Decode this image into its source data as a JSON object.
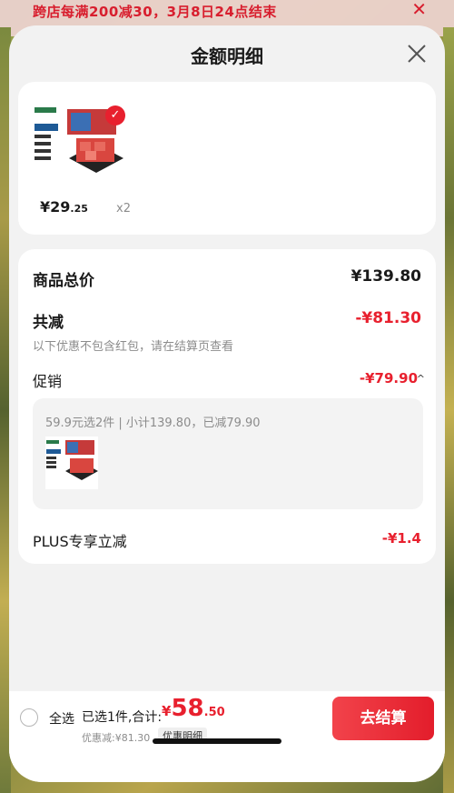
{
  "background_banner": {
    "text": "跨店每满200减30，3月8日24点结束",
    "close_icon": "close-icon"
  },
  "sheet": {
    "title": "金额明细",
    "close_icon": "close-icon"
  },
  "product": {
    "price_int": "¥29",
    "price_dec": ".25",
    "quantity": "x2",
    "thumb_icon": "product-image",
    "check_icon": "check-icon"
  },
  "summary": {
    "total_label": "商品总价",
    "total_value": "¥139.80",
    "discount_label": "共减",
    "discount_value": "-¥81.30",
    "discount_note": "以下优惠不包含红包，请在结算页查看",
    "promo_label": "促销",
    "promo_value": "-¥79.90",
    "promo_chevron_icon": "chevron-up-icon",
    "promo_box_text": "59.9元选2件 | 小计139.80，已减79.90",
    "plus_label": "PLUS专享立减",
    "plus_value": "-¥1.4"
  },
  "footer": {
    "select_all": "全选",
    "selected_text": "已选1件,合计:",
    "total_currency": "¥",
    "total_int": "58",
    "total_dec": ".50",
    "discount_text": "优惠减:¥81.30",
    "discount_detail_label": "优惠明细",
    "checkout_label": "去结算"
  },
  "colors": {
    "accent": "#e8202e",
    "background": "#f2f2f2",
    "muted": "#8c8c8c"
  }
}
